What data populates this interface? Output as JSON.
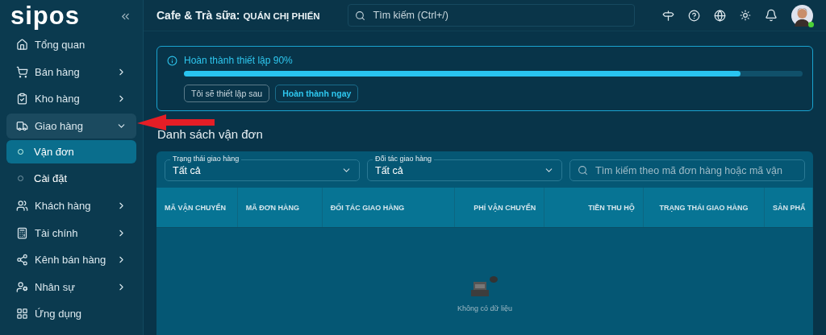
{
  "sidebar": {
    "logo": "sipos",
    "items": [
      {
        "label": "Tổng quan",
        "has_arrow": false,
        "expanded": false
      },
      {
        "label": "Bán hàng",
        "has_arrow": true,
        "expanded": false
      },
      {
        "label": "Kho hàng",
        "has_arrow": true,
        "expanded": false
      },
      {
        "label": "Giao hàng",
        "has_arrow": true,
        "expanded": true,
        "children": [
          {
            "label": "Vận đơn",
            "selected": true
          },
          {
            "label": "Cài đặt",
            "selected": false
          }
        ]
      },
      {
        "label": "Khách hàng",
        "has_arrow": true,
        "expanded": false
      },
      {
        "label": "Tài chính",
        "has_arrow": true,
        "expanded": false
      },
      {
        "label": "Kênh bán hàng",
        "has_arrow": true,
        "expanded": false
      },
      {
        "label": "Nhân sự",
        "has_arrow": true,
        "expanded": false
      },
      {
        "label": "Ứng dụng",
        "has_arrow": false,
        "expanded": false
      }
    ]
  },
  "header": {
    "title_prefix": "Cafe & Trà sữa:",
    "title_store": "QUÁN CHỊ PHIẾN",
    "search": {
      "placeholder": "Tìm kiếm (Ctrl+/)"
    }
  },
  "setup": {
    "title": "Hoàn thành thiết lập 90%",
    "level": 0.9,
    "buttons": [
      {
        "label": "Tôi sẽ thiết lập sau",
        "kind": "secondary"
      },
      {
        "label": "Hoàn thành ngay",
        "kind": "primary"
      }
    ]
  },
  "heading": "Danh sách vận đơn",
  "filters": [
    {
      "label": "Trạng thái giao hàng",
      "value": "Tất cả"
    },
    {
      "label": "Đối tác giao hàng",
      "value": "Tất cả"
    }
  ],
  "search": {
    "placeholder": "Tìm kiếm theo mã đơn hàng hoặc mã vận"
  },
  "table": {
    "columns": [
      "MÃ VẬN CHUYỂN",
      "MÃ ĐƠN HÀNG",
      "ĐỐI TÁC GIAO HÀNG",
      "PHÍ VẬN CHUYỂN",
      "TIỀN THU HỘ",
      "TRẠNG THÁI GIAO HÀNG",
      "SẢN PHẨ"
    ],
    "empty_text": "Không có dữ liệu"
  }
}
